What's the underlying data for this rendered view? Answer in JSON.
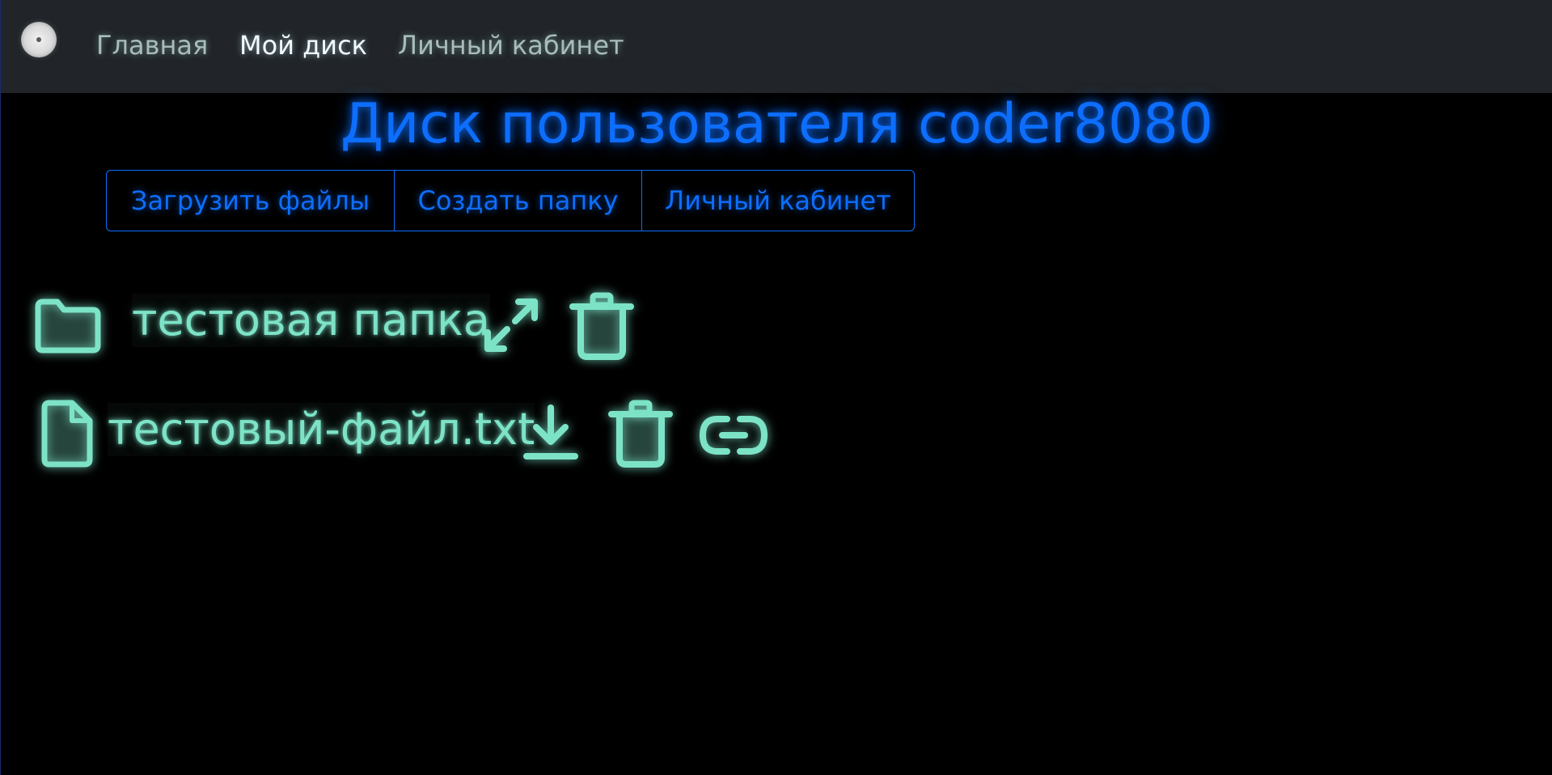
{
  "navbar": {
    "logo_icon": "disc-icon",
    "links": [
      {
        "label": "Главная",
        "active": false
      },
      {
        "label": "Мой диск",
        "active": true
      },
      {
        "label": "Личный кабинет",
        "active": false
      }
    ]
  },
  "page": {
    "title": "Диск пользователя coder8080"
  },
  "toolbar": {
    "upload_label": "Загрузить файлы",
    "create_folder_label": "Создать папку",
    "account_label": "Личный кабинет"
  },
  "items": [
    {
      "type": "folder",
      "name": "тестовая папка",
      "icons": [
        "folder-icon",
        "expand-icon",
        "trash-icon"
      ]
    },
    {
      "type": "file",
      "name": "тестовый-файл.txt",
      "icons": [
        "file-icon",
        "download-icon",
        "trash-icon",
        "link-icon"
      ]
    }
  ],
  "colors": {
    "navbar_bg": "#212529",
    "page_bg": "#000000",
    "accent": "#0d6efd",
    "item_glow": "#7de3c7"
  }
}
